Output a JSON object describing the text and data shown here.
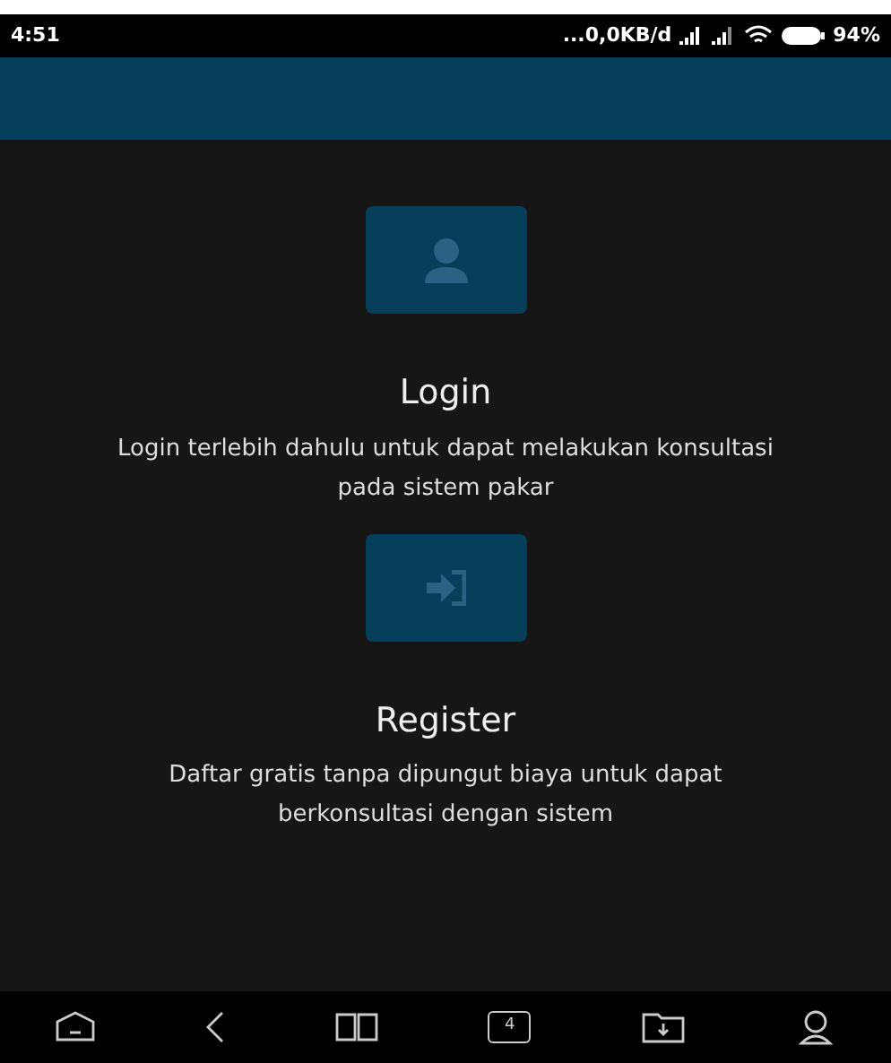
{
  "status_bar": {
    "time": "4:51",
    "network_speed": "...0,0KB/d",
    "battery": "94%"
  },
  "sections": [
    {
      "kind": "login",
      "title": "Login",
      "description": "Login terlebih dahulu untuk dapat melakukan konsultasi pada sistem pakar"
    },
    {
      "kind": "register",
      "title": "Register",
      "description": "Daftar gratis tanpa dipungut biaya untuk dapat berkonsultasi dengan sistem"
    }
  ],
  "bottom_nav": {
    "tab_count": "4"
  }
}
